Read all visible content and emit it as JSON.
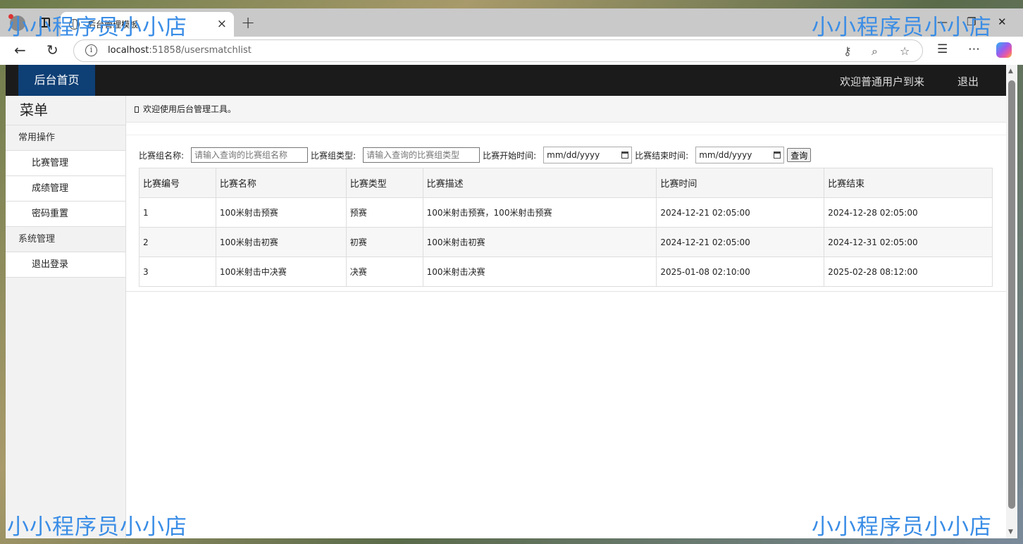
{
  "browser": {
    "tab_title": "后台管理模板",
    "url_host": "localhost",
    "url_rest": ":51858/usersmatchlist",
    "close_glyph": "×",
    "newtab_glyph": "+"
  },
  "nav": {
    "home": "后台首页",
    "welcome": "欢迎普通用户到来",
    "logout": "退出"
  },
  "sidebar": {
    "title": "菜单",
    "groups": [
      {
        "label": "常用操作",
        "items": [
          "比赛管理",
          "成绩管理",
          "密码重置"
        ]
      },
      {
        "label": "系统管理",
        "items": [
          "退出登录"
        ]
      }
    ]
  },
  "main": {
    "welcome_text": "欢迎使用后台管理工具。",
    "filters": {
      "name_label": "比赛组名称:",
      "name_placeholder": "请输入查询的比赛组名称",
      "type_label": "比赛组类型:",
      "type_placeholder": "请输入查询的比赛组类型",
      "start_label": "比赛开始时间:",
      "start_value": "mm/dd/yyyy",
      "end_label": "比赛结束时间:",
      "end_value": "mm/dd/yyyy",
      "search_label": "查询"
    },
    "table": {
      "headers": [
        "比赛编号",
        "比赛名称",
        "比赛类型",
        "比赛描述",
        "比赛时间",
        "比赛结束"
      ],
      "rows": [
        [
          "1",
          "100米射击预赛",
          "预赛",
          "100米射击预赛，100米射击预赛",
          "2024-12-21 02:05:00",
          "2024-12-28 02:05:00"
        ],
        [
          "2",
          "100米射击初赛",
          "初赛",
          "100米射击初赛",
          "2024-12-21 02:05:00",
          "2024-12-31 02:05:00"
        ],
        [
          "3",
          "100米射击中决赛",
          "决赛",
          "100米射击决赛",
          "2025-01-08 02:10:00",
          "2025-02-28 08:12:00"
        ]
      ]
    }
  },
  "watermark": "小小程序员小小店",
  "colors": {
    "nav_bg": "#1b1b1b",
    "home_bg": "#0e3f75",
    "watermark": "#3a8de6"
  }
}
